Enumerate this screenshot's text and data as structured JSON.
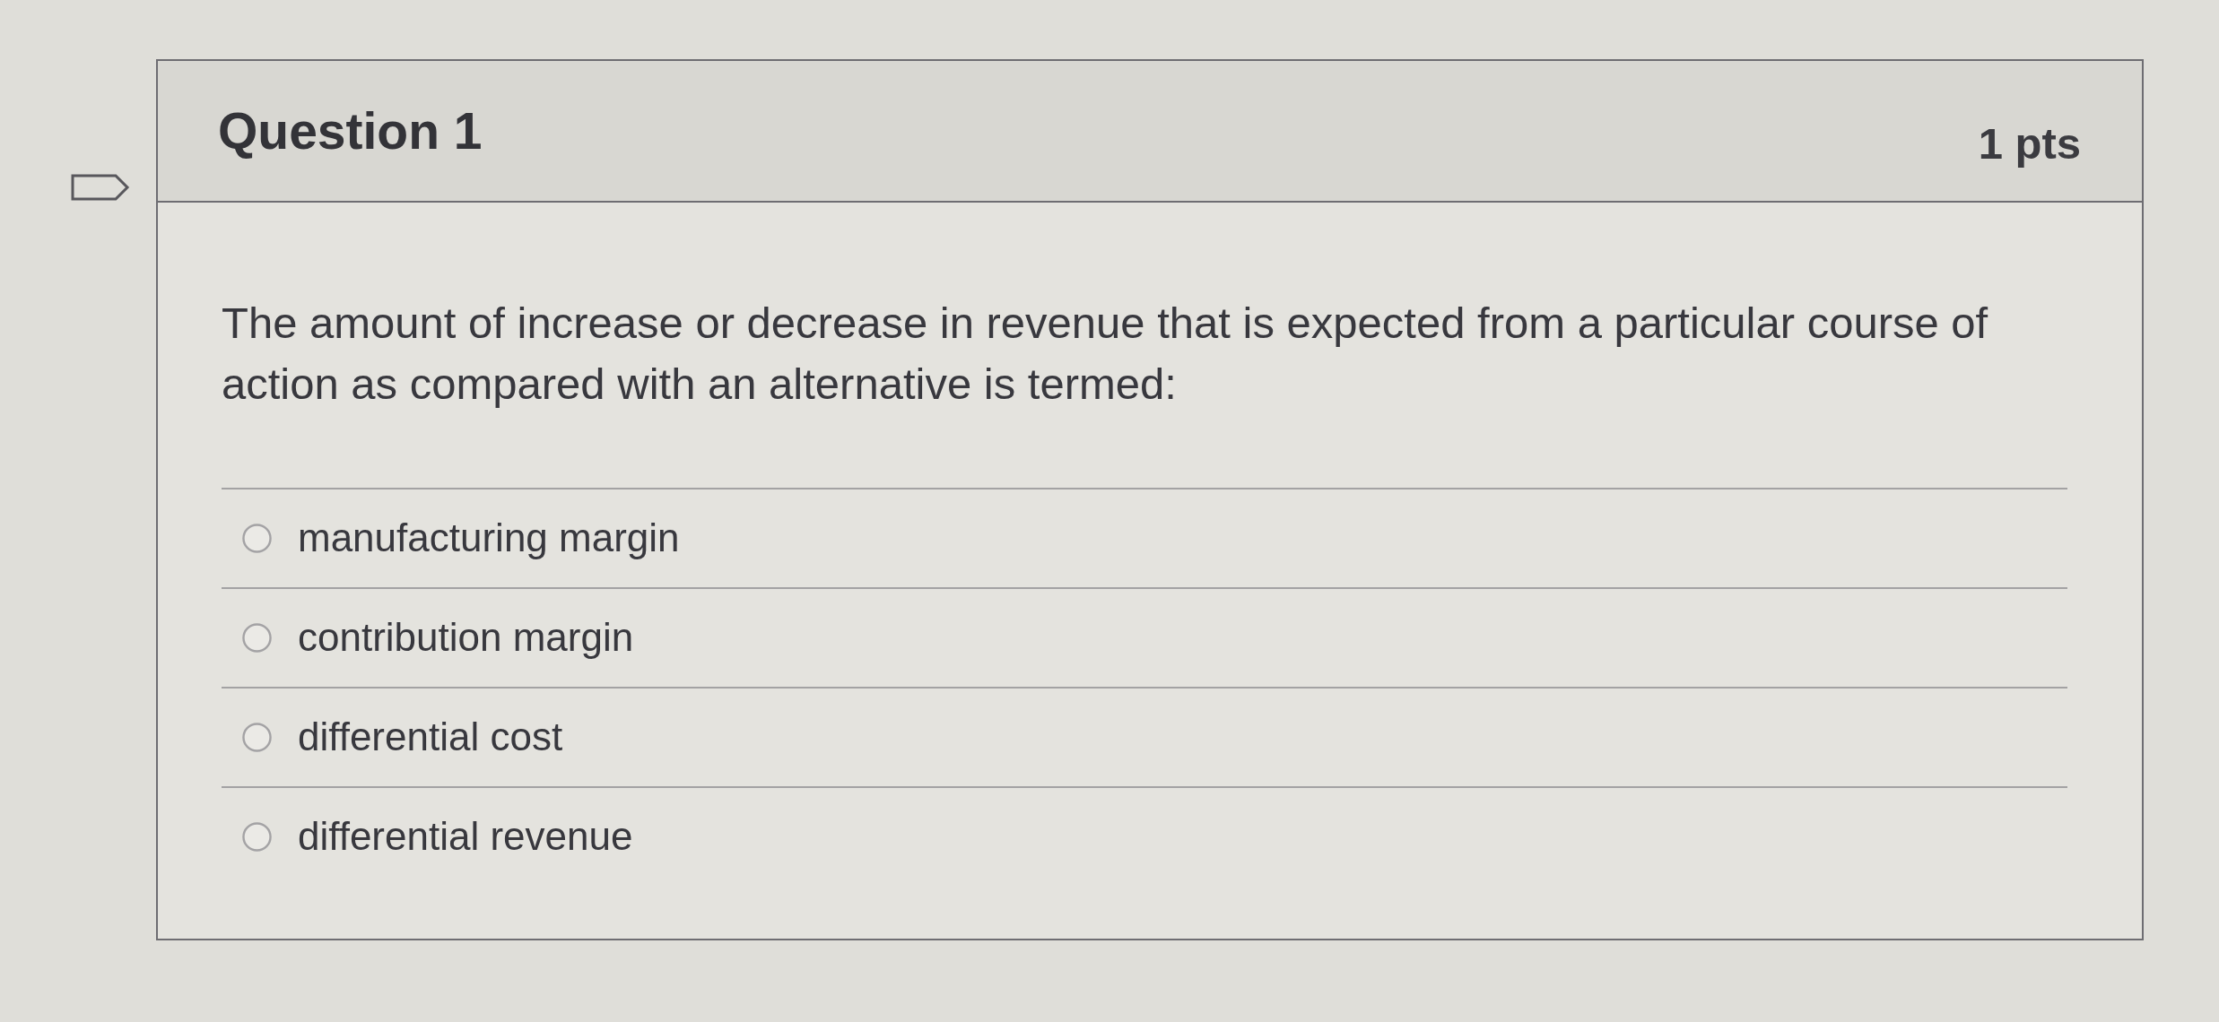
{
  "question": {
    "title": "Question 1",
    "points": "1 pts",
    "flagged": false,
    "text": "The amount of increase or decrease in revenue that is expected from a particular course of action as compared with an alternative is termed:",
    "answers": [
      {
        "label": "manufacturing margin",
        "selected": false
      },
      {
        "label": "contribution margin",
        "selected": false
      },
      {
        "label": "differential cost",
        "selected": false
      },
      {
        "label": "differential revenue",
        "selected": false
      }
    ]
  }
}
